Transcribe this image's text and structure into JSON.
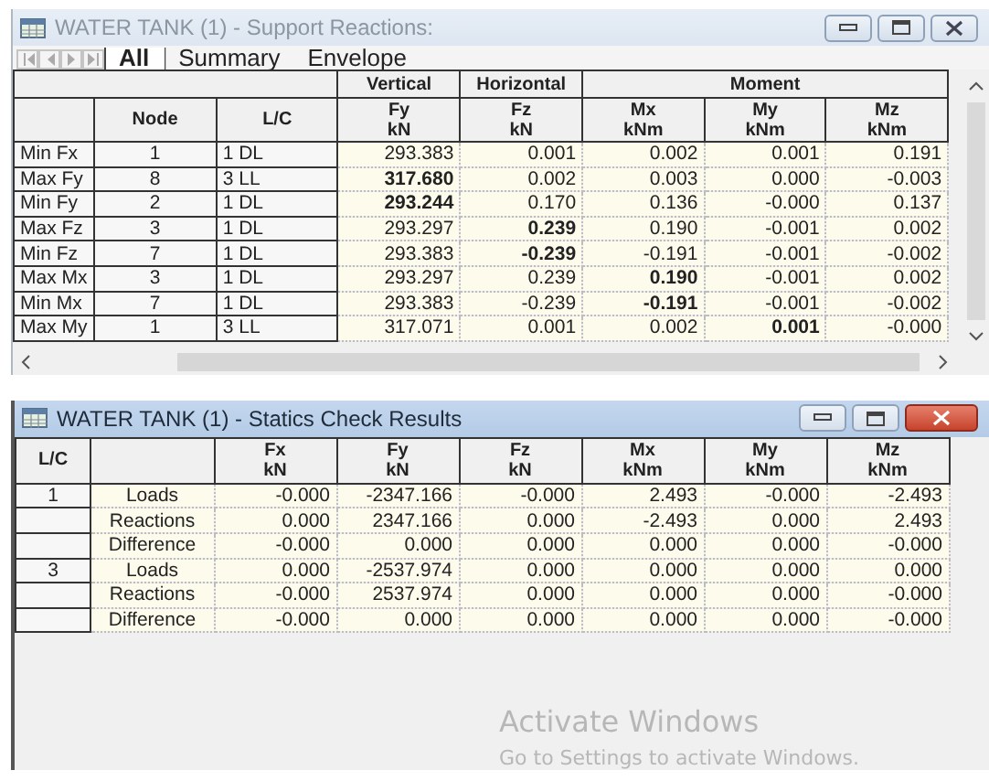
{
  "windows": [
    {
      "kind": "reactions",
      "title": "WATER TANK (1) - Support Reactions:",
      "active": false,
      "tabs": [
        {
          "label": "All",
          "selected": true
        },
        {
          "label": "Summary",
          "selected": false
        },
        {
          "label": "Envelope",
          "selected": false
        }
      ],
      "group_headers": [
        "Vertical",
        "Horizontal",
        "Moment"
      ],
      "columns": [
        {},
        {
          "name": "Node"
        },
        {
          "name": "L/C"
        },
        {
          "name": "Fy",
          "unit": "kN"
        },
        {
          "name": "Fz",
          "unit": "kN"
        },
        {
          "name": "Mx",
          "unit": "kNm"
        },
        {
          "name": "My",
          "unit": "kNm"
        },
        {
          "name": "Mz",
          "unit": "kNm"
        }
      ],
      "rows": [
        {
          "cells": [
            {
              "text": "Min Fx",
              "bold": false
            },
            {
              "text": "1",
              "bold": false
            },
            {
              "text": "1 DL",
              "bold": false
            },
            {
              "text": "293.383",
              "bold": false
            },
            {
              "text": "0.001",
              "bold": false
            },
            {
              "text": "0.002",
              "bold": false
            },
            {
              "text": "0.001",
              "bold": false
            },
            {
              "text": "0.191",
              "bold": false
            }
          ]
        },
        {
          "cells": [
            {
              "text": "Max Fy",
              "bold": false
            },
            {
              "text": "8",
              "bold": false
            },
            {
              "text": "3 LL",
              "bold": false
            },
            {
              "text": "317.680",
              "bold": true
            },
            {
              "text": "0.002",
              "bold": false
            },
            {
              "text": "0.003",
              "bold": false
            },
            {
              "text": "0.000",
              "bold": false
            },
            {
              "text": "-0.003",
              "bold": false
            }
          ]
        },
        {
          "cells": [
            {
              "text": "Min Fy",
              "bold": false
            },
            {
              "text": "2",
              "bold": false
            },
            {
              "text": "1 DL",
              "bold": false
            },
            {
              "text": "293.244",
              "bold": true
            },
            {
              "text": "0.170",
              "bold": false
            },
            {
              "text": "0.136",
              "bold": false
            },
            {
              "text": "-0.000",
              "bold": false
            },
            {
              "text": "0.137",
              "bold": false
            }
          ]
        },
        {
          "cells": [
            {
              "text": "Max Fz",
              "bold": false
            },
            {
              "text": "3",
              "bold": false
            },
            {
              "text": "1 DL",
              "bold": false
            },
            {
              "text": "293.297",
              "bold": false
            },
            {
              "text": "0.239",
              "bold": true
            },
            {
              "text": "0.190",
              "bold": false
            },
            {
              "text": "-0.001",
              "bold": false
            },
            {
              "text": "0.002",
              "bold": false
            }
          ]
        },
        {
          "cells": [
            {
              "text": "Min Fz",
              "bold": false
            },
            {
              "text": "7",
              "bold": false
            },
            {
              "text": "1 DL",
              "bold": false
            },
            {
              "text": "293.383",
              "bold": false
            },
            {
              "text": "-0.239",
              "bold": true
            },
            {
              "text": "-0.191",
              "bold": false
            },
            {
              "text": "-0.001",
              "bold": false
            },
            {
              "text": "-0.002",
              "bold": false
            }
          ]
        },
        {
          "cells": [
            {
              "text": "Max Mx",
              "bold": false
            },
            {
              "text": "3",
              "bold": false
            },
            {
              "text": "1 DL",
              "bold": false
            },
            {
              "text": "293.297",
              "bold": false
            },
            {
              "text": "0.239",
              "bold": false
            },
            {
              "text": "0.190",
              "bold": true
            },
            {
              "text": "-0.001",
              "bold": false
            },
            {
              "text": "0.002",
              "bold": false
            }
          ]
        },
        {
          "cells": [
            {
              "text": "Min Mx",
              "bold": false
            },
            {
              "text": "7",
              "bold": false
            },
            {
              "text": "1 DL",
              "bold": false
            },
            {
              "text": "293.383",
              "bold": false
            },
            {
              "text": "-0.239",
              "bold": false
            },
            {
              "text": "-0.191",
              "bold": true
            },
            {
              "text": "-0.001",
              "bold": false
            },
            {
              "text": "-0.002",
              "bold": false
            }
          ]
        },
        {
          "cells": [
            {
              "text": "Max My",
              "bold": false
            },
            {
              "text": "1",
              "bold": false
            },
            {
              "text": "3 LL",
              "bold": false
            },
            {
              "text": "317.071",
              "bold": false
            },
            {
              "text": "0.001",
              "bold": false
            },
            {
              "text": "0.002",
              "bold": false
            },
            {
              "text": "0.001",
              "bold": true
            },
            {
              "text": "-0.000",
              "bold": false
            }
          ]
        }
      ]
    },
    {
      "kind": "statics",
      "title": "WATER TANK (1) - Statics Check Results",
      "active": true,
      "columns": [
        {
          "name": "L/C"
        },
        {},
        {
          "name": "Fx",
          "unit": "kN"
        },
        {
          "name": "Fy",
          "unit": "kN"
        },
        {
          "name": "Fz",
          "unit": "kN"
        },
        {
          "name": "Mx",
          "unit": "kNm"
        },
        {
          "name": "My",
          "unit": "kNm"
        },
        {
          "name": "Mz",
          "unit": "kNm"
        }
      ],
      "rows": [
        {
          "cells": [
            "1",
            "Loads",
            "-0.000",
            "-2347.166",
            "-0.000",
            "2.493",
            "-0.000",
            "-2.493"
          ]
        },
        {
          "cells": [
            "",
            "Reactions",
            "0.000",
            "2347.166",
            "0.000",
            "-2.493",
            "0.000",
            "2.493"
          ]
        },
        {
          "cells": [
            "",
            "Difference",
            "-0.000",
            "0.000",
            "0.000",
            "0.000",
            "0.000",
            "-0.000"
          ]
        },
        {
          "cells": [
            "3",
            "Loads",
            "0.000",
            "-2537.974",
            "0.000",
            "0.000",
            "0.000",
            "0.000"
          ]
        },
        {
          "cells": [
            "",
            "Reactions",
            "-0.000",
            "2537.974",
            "0.000",
            "0.000",
            "0.000",
            "-0.000"
          ]
        },
        {
          "cells": [
            "",
            "Difference",
            "-0.000",
            "0.000",
            "0.000",
            "0.000",
            "0.000",
            "-0.000"
          ]
        }
      ]
    }
  ],
  "os_notice": {
    "title": "Activate Windows",
    "subtitle": "Go to Settings to activate Windows."
  }
}
